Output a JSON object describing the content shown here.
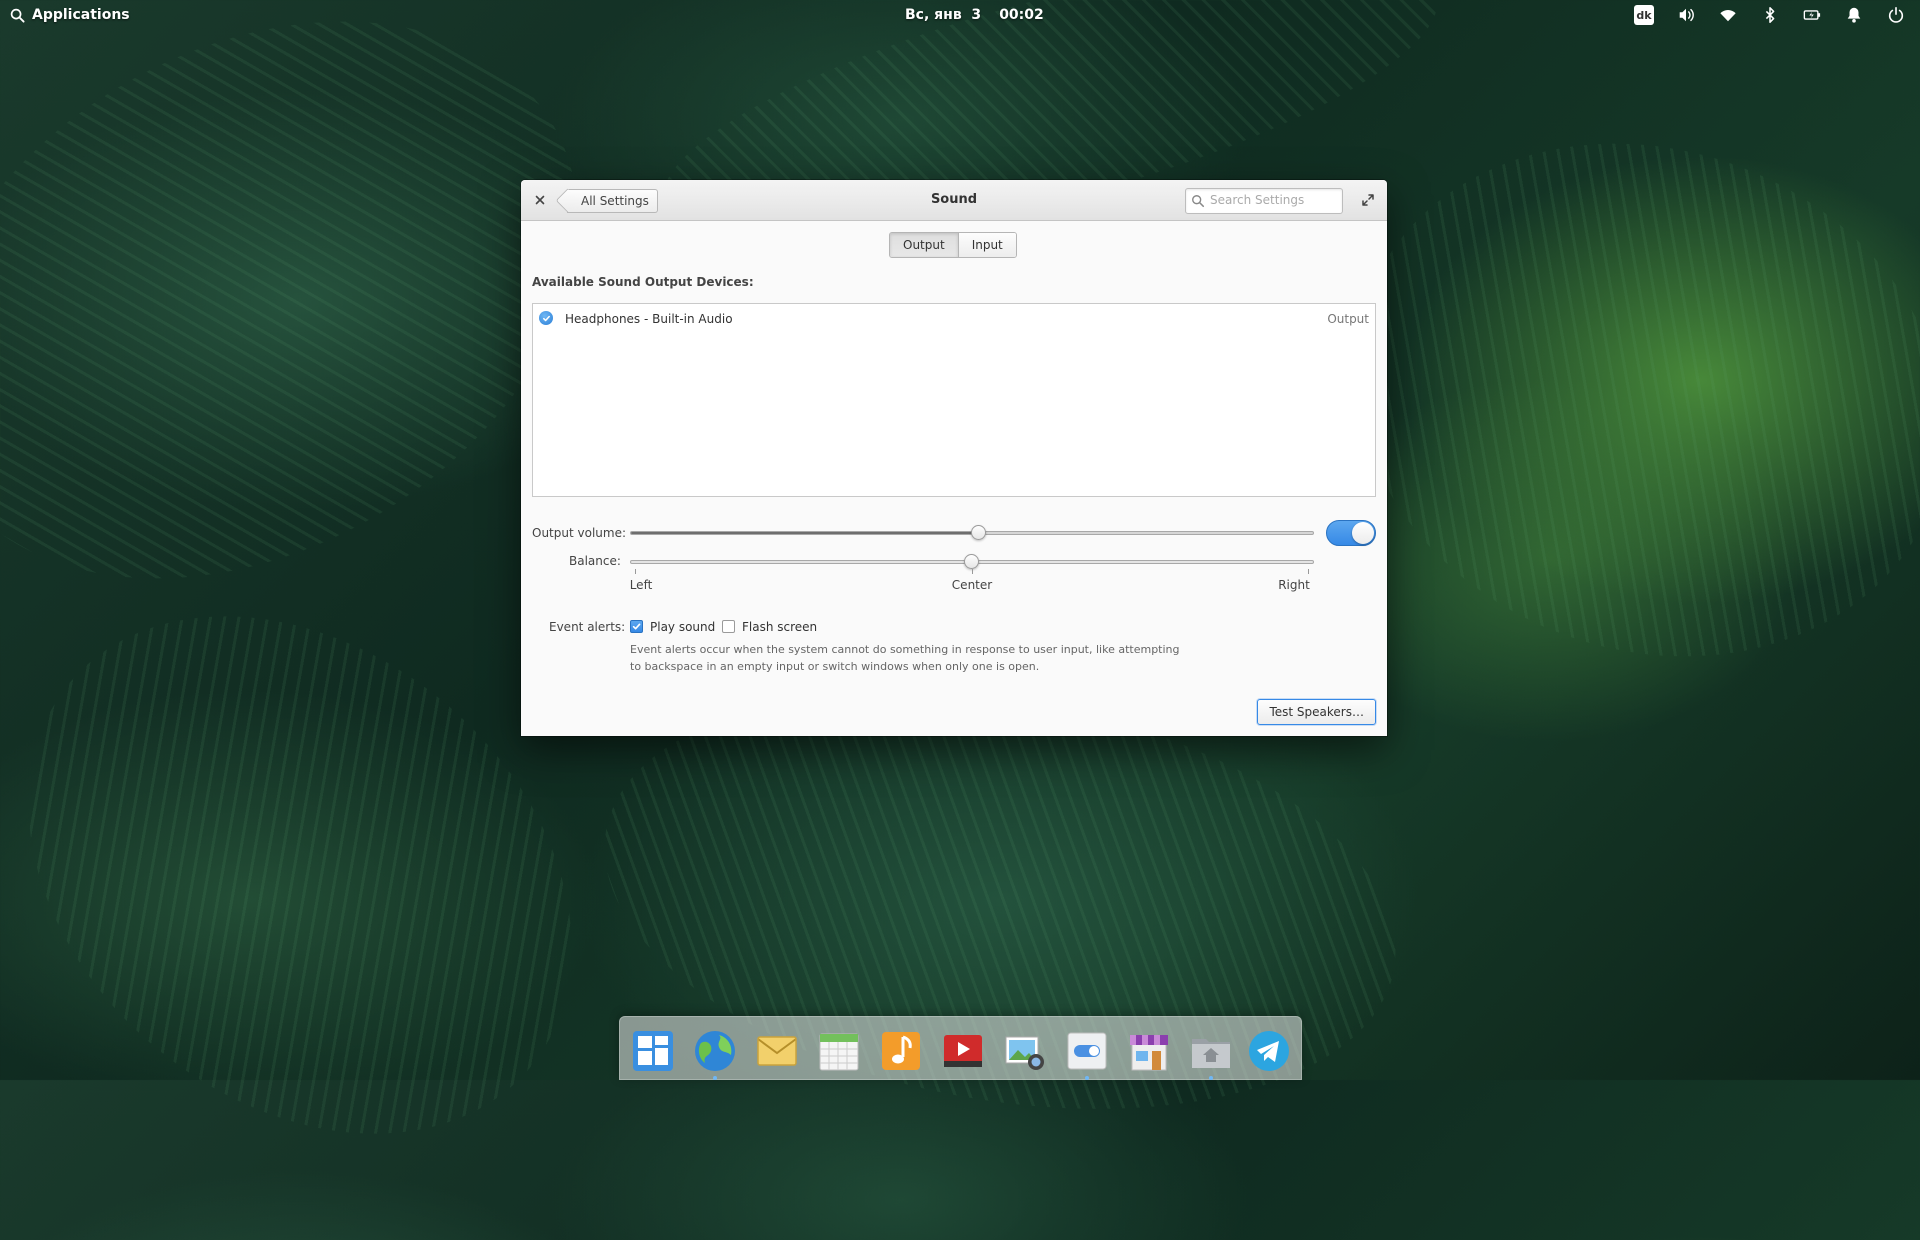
{
  "panel": {
    "applications_label": "Applications",
    "date": "Вс, янв  3",
    "time": "00:02",
    "keyboard_layout": "dk"
  },
  "window": {
    "title": "Sound",
    "back_label": "All Settings",
    "search_placeholder": "Search Settings"
  },
  "tabs": {
    "output": "Output",
    "input": "Input",
    "active": "output"
  },
  "devices_section": {
    "label": "Available Sound Output Devices:",
    "devices": [
      {
        "name": "Headphones - Built-in Audio",
        "type": "Output",
        "selected": true
      }
    ]
  },
  "output_volume": {
    "label": "Output volume:",
    "value_percent": 51,
    "muted": false
  },
  "balance": {
    "label": "Balance:",
    "left": "Left",
    "center": "Center",
    "right": "Right",
    "value": 0.5
  },
  "event_alerts": {
    "label": "Event alerts:",
    "play_sound_label": "Play sound",
    "play_sound_checked": true,
    "flash_screen_label": "Flash screen",
    "flash_screen_checked": false,
    "description": "Event alerts occur when the system cannot do something in response to user input, like attempting to backspace in an empty input or switch windows when only one is open."
  },
  "test_button": "Test Speakers…",
  "colors": {
    "accent": "#3689e6",
    "text": "#333333"
  },
  "dock": {
    "items": [
      {
        "icon": "multitasking-view-icon",
        "running": false
      },
      {
        "icon": "web-browser-icon",
        "running": true
      },
      {
        "icon": "mail-icon",
        "running": false
      },
      {
        "icon": "calendar-icon",
        "running": false
      },
      {
        "icon": "music-icon",
        "running": false
      },
      {
        "icon": "videos-icon",
        "running": false
      },
      {
        "icon": "photos-icon",
        "running": false
      },
      {
        "icon": "system-settings-icon",
        "running": true
      },
      {
        "icon": "app-center-icon",
        "running": false
      },
      {
        "icon": "files-icon",
        "running": true
      },
      {
        "icon": "telegram-icon",
        "running": false
      }
    ]
  }
}
